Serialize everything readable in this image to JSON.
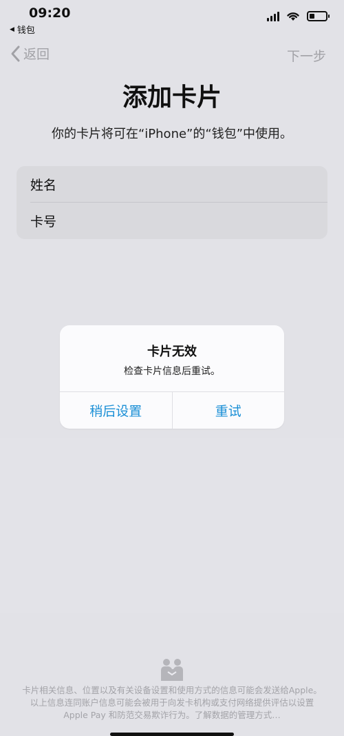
{
  "status_bar": {
    "time": "09:20",
    "back_app_label": "钱包",
    "back_app_icon": "triangle-left-icon",
    "battery_level": 0.3
  },
  "nav": {
    "back_label": "返回",
    "next_label": "下一步",
    "disabled_color": "#a8a8ad"
  },
  "page": {
    "title": "添加卡片",
    "subtitle": "你的卡片将可在“iPhone”的“钱包”中使用。"
  },
  "form": {
    "fields": [
      {
        "label": "姓名"
      },
      {
        "label": "卡号"
      }
    ]
  },
  "alert": {
    "title": "卡片无效",
    "message": "检查卡片信息后重试。",
    "buttons": [
      {
        "label": "稍后设置"
      },
      {
        "label": "重试"
      }
    ],
    "button_color": "#1a8fd6"
  },
  "footer": {
    "icon": "privacy-handshake-icon",
    "text": "卡片相关信息、位置以及有关设备设置和使用方式的信息可能会发送给Apple。以上信息连同账户信息可能会被用于向发卡机构或支付网络提供评估以设置 Apple Pay 和防范交易欺诈行为。了解数据的管理方式…"
  }
}
